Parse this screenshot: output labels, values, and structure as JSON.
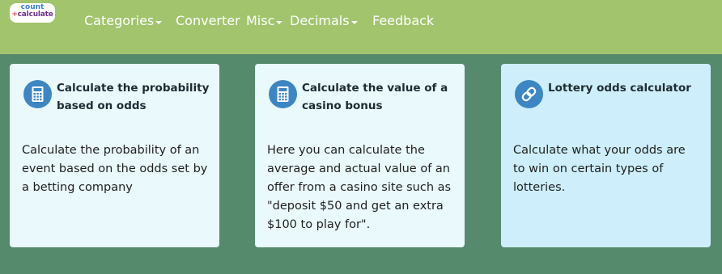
{
  "brand": {
    "logo_line1": "count",
    "logo_plus": "+",
    "logo_line2": "calculate"
  },
  "nav": {
    "categories": "Categories",
    "converter": "Converter",
    "misc": "Misc",
    "decimals": "Decimals",
    "feedback": "Feedback"
  },
  "cards": [
    {
      "icon": "calculator-icon",
      "title": "Calculate the probability based on odds",
      "description": "Calculate the probability of an event based on the odds set by a betting company"
    },
    {
      "icon": "calculator-icon",
      "title": "Calculate the value of a casino bonus",
      "description": "Here you can calculate the average and actual value of an offer from a casino site such as \"deposit $50 and get an extra $100 to play for\"."
    },
    {
      "icon": "link-icon",
      "title": "Lottery odds calculator",
      "description": "Calculate what your odds are to win on certain types of lotteries."
    }
  ],
  "colors": {
    "navbar": "#a1c46d",
    "background": "#568a6c",
    "card": "#eaf9fc",
    "card_highlight": "#cdeefa",
    "icon_circle": "#3d86c4"
  }
}
